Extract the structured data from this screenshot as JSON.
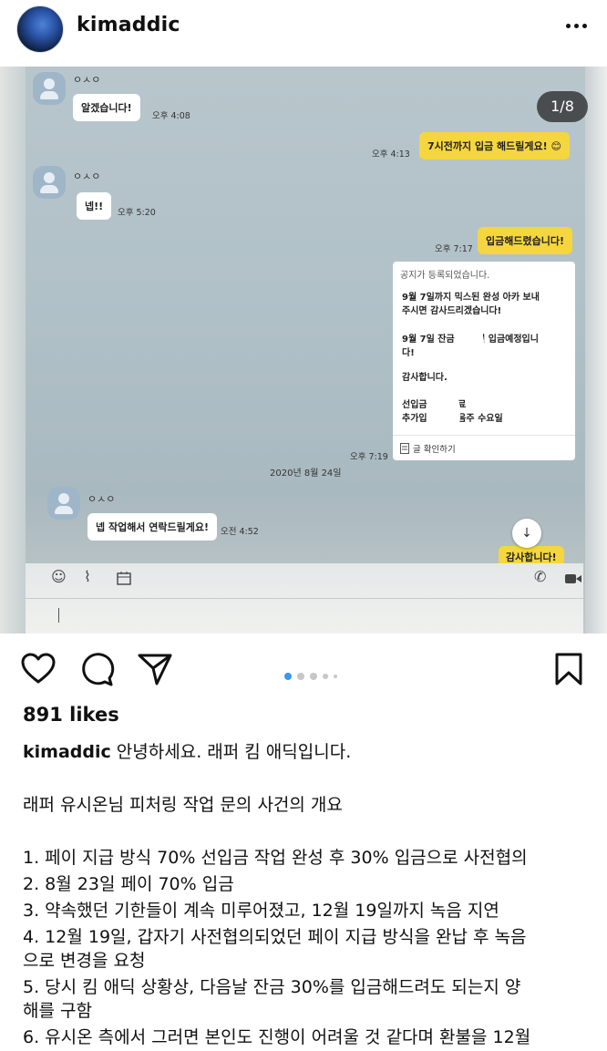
{
  "post": {
    "username": "kimaddic",
    "likes": "891 likes",
    "caption_intro": "안녕하세요. 래퍼 킴 애딕입니다.",
    "caption_heading": "래퍼 유시온님 피처링 작업 문의 사건의 개요",
    "caption_items": [
      "1. 페이 지급 방식 70% 선입금 작업 완성 후 30% 입금으로 사전협의",
      "2. 8월 23일 페이 70% 입금",
      "3. 약속했던 기한들이 계속 미루어졌고, 12월 19일까지 녹음 지연",
      "4. 12월 19일, 갑자기 사전협의되었던 페이 지급 방식을 완납 후 녹음",
      "으로 변경을 요청",
      "5. 당시 킴 애딕 상황상, 다음날 잔금 30%를 입금해드려도 되는지 양",
      "해를 구함",
      "6. 유시온 측에서 그러면 본인도 진행이 어려울 것 같다며 환불을 12월"
    ],
    "carousel_counter": "1/8",
    "carousel_dots": 5,
    "carousel_active": 0
  },
  "chat": {
    "sender_name": "ㅇㅅㅇ",
    "m1": {
      "text": "알겠습니다!",
      "time": "오후 4:08"
    },
    "m2": {
      "text": "7시전까지 입금 해드릴게요! 😊",
      "time": "오후 4:13"
    },
    "m3": {
      "text": "넵!!",
      "time": "오후 5:20"
    },
    "m4": {
      "text": "입금해드렸습니다!",
      "time": "오후 7:17"
    },
    "notice": {
      "header": "공지가 등록되었습니다.",
      "line1a": "9월 7일까지 믹스된 완성 아카 보내",
      "line1b": "주시면 감사드리겠습니다!",
      "line2a": "9월 7일 잔금",
      "line2b": "원 입금예정입니",
      "line2c": "다!",
      "line3": "감사합니다.",
      "line4a": "선입금",
      "line4b": "완료",
      "line5a": "추가입",
      "line5b": "다음주 수요일",
      "footer": "글 확인하기",
      "time": "오후 7:19"
    },
    "date_divider": "2020년 8월 24일",
    "m5": {
      "text": "넵 작업해서 연락드릴게요!",
      "time": "오전 4:52"
    },
    "m6": {
      "text": "감사합니다!"
    }
  },
  "colors": {
    "kakao_yellow": "#f5d63e",
    "chat_background": "#b1c1c8",
    "carousel_active_dot": "#3897f0"
  }
}
